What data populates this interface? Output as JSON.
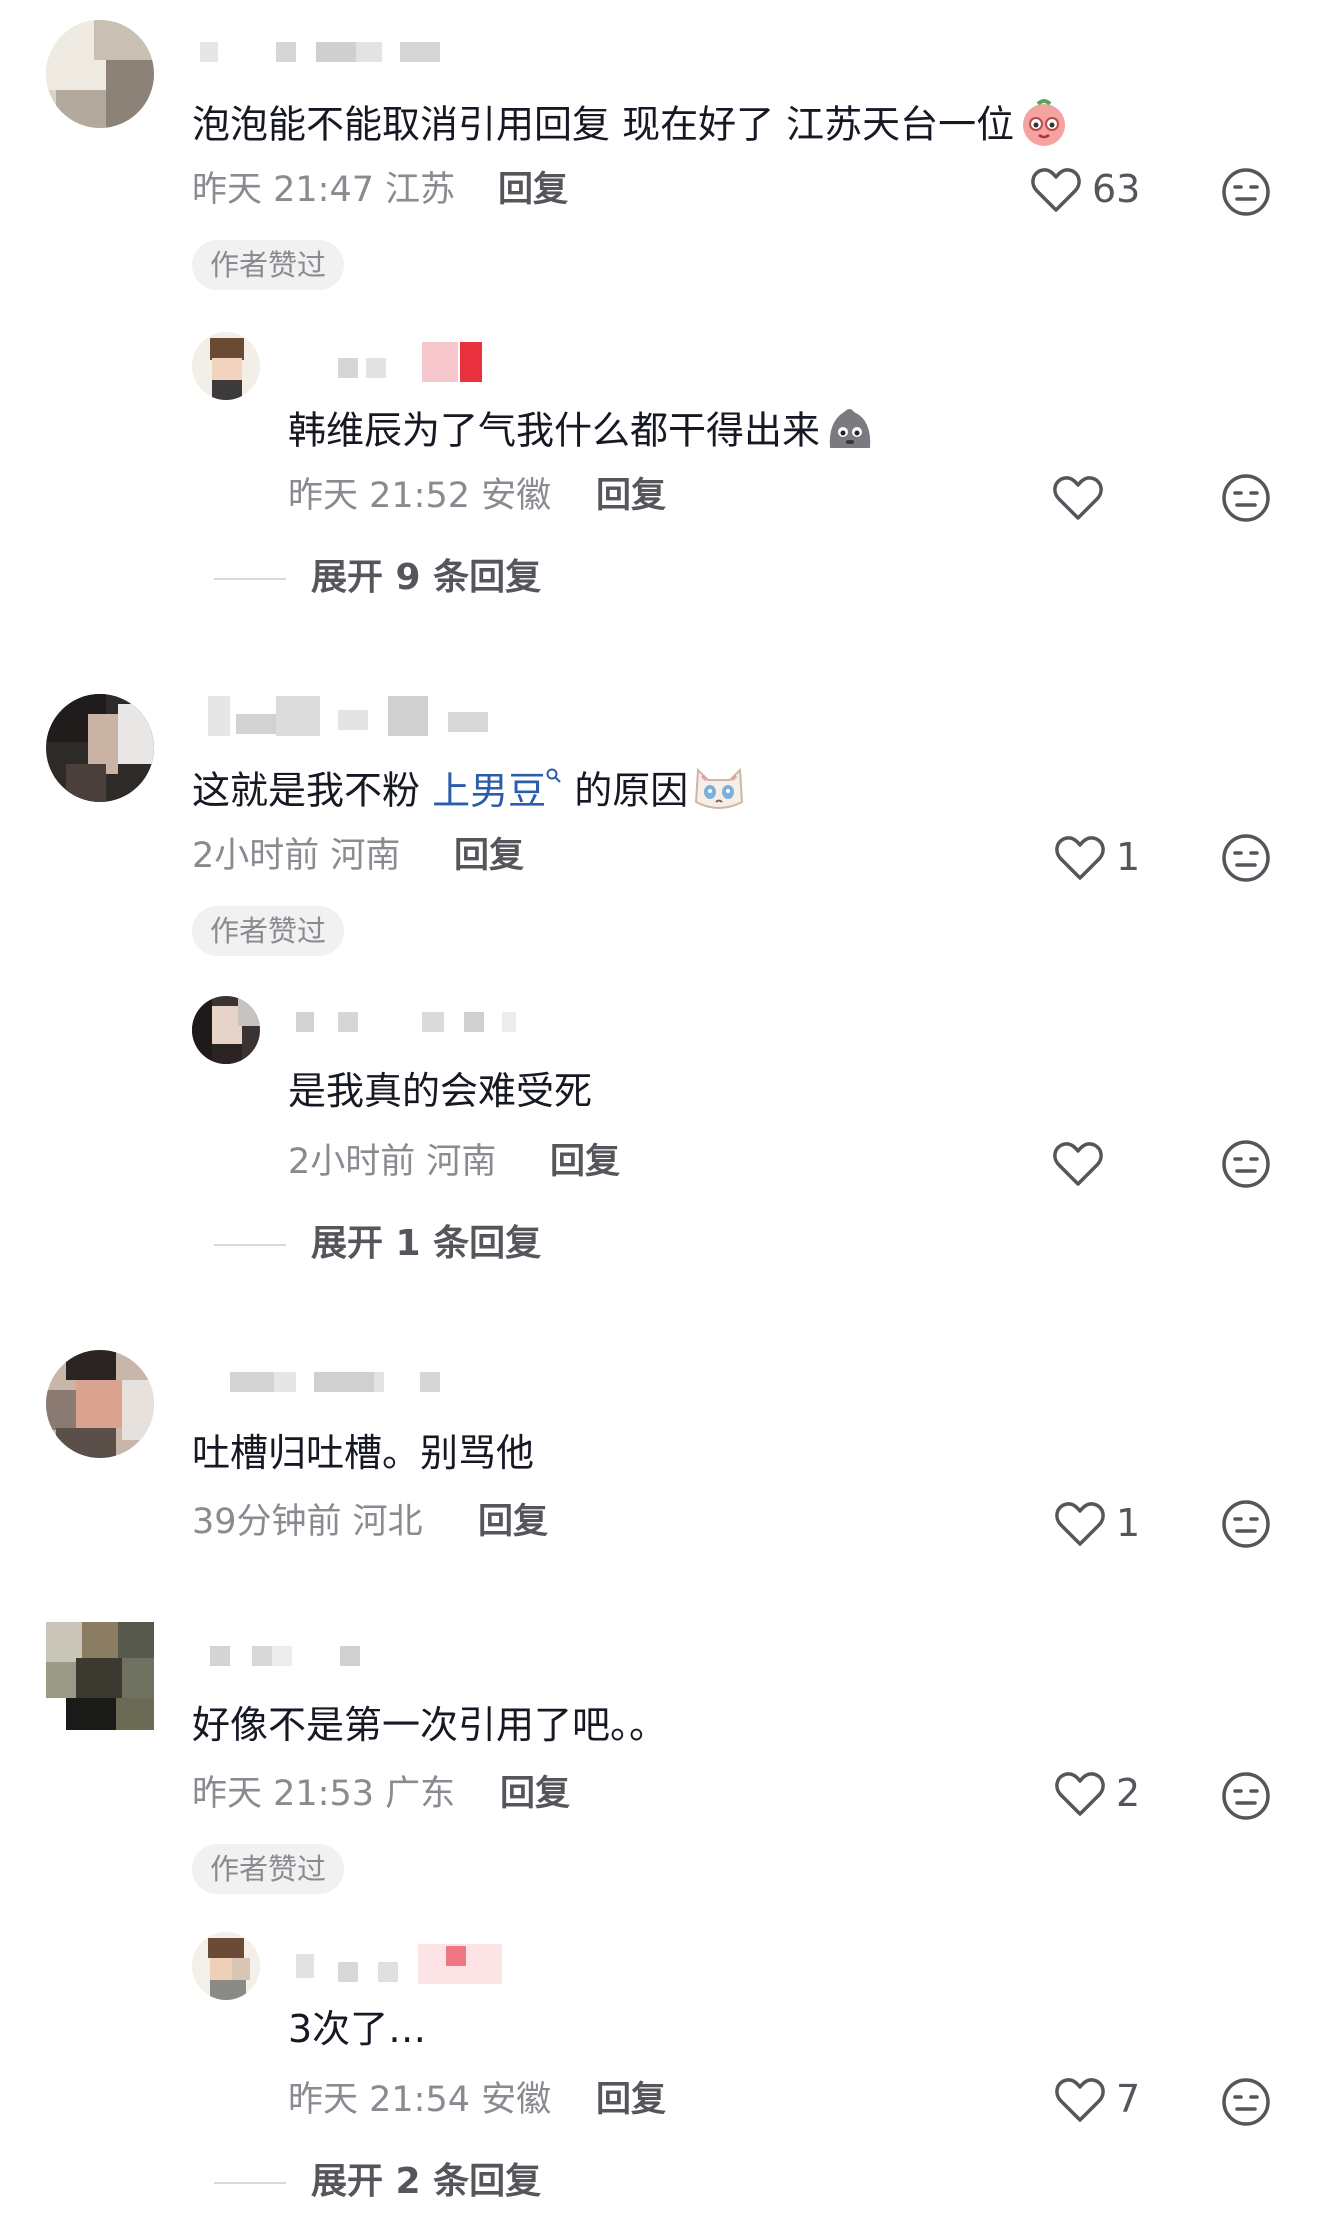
{
  "comments": [
    {
      "text": "泡泡能不能取消引用回复 现在好了 江苏天台一位",
      "time_location": "昨天 21:47 江苏",
      "reply_label": "回复",
      "likes": "63",
      "badge": "作者赞过",
      "emoji": "pink-blush-face-emoji",
      "replies": [
        {
          "text": "韩维辰为了气我什么都干得出来",
          "time_location": "昨天 21:52 安徽",
          "reply_label": "回复",
          "likes": "",
          "emoji": "gray-blob-face-emoji"
        }
      ],
      "expand_label": "展开 9 条回复"
    },
    {
      "text_before": "这就是我不粉",
      "mention": "上男豆",
      "text_after": "的原因",
      "time_location": "2小时前 河南",
      "reply_label": "回复",
      "likes": "1",
      "badge": "作者赞过",
      "emoji": "crying-cat-emoji",
      "replies": [
        {
          "text": "是我真的会难受死",
          "time_location": "2小时前 河南",
          "reply_label": "回复",
          "likes": ""
        }
      ],
      "expand_label": "展开 1 条回复"
    },
    {
      "text": "吐槽归吐槽。别骂他",
      "time_location": "39分钟前 河北",
      "reply_label": "回复",
      "likes": "1"
    },
    {
      "text": "好像不是第一次引用了吧。。",
      "time_location": "昨天 21:53 广东",
      "reply_label": "回复",
      "likes": "2",
      "badge": "作者赞过",
      "replies": [
        {
          "text": "3次了…",
          "time_location": "昨天 21:54 安徽",
          "reply_label": "回复",
          "likes": "7"
        }
      ],
      "expand_label": "展开 2 条回复"
    }
  ],
  "icons": {
    "like": "heart-outline-icon",
    "dislike": "neutral-face-icon",
    "mention_search": "search-icon"
  },
  "colors": {
    "text": "#161823",
    "meta": "#8a8b91",
    "mention": "#2b5da8",
    "badge_bg": "#f1f1f2"
  }
}
